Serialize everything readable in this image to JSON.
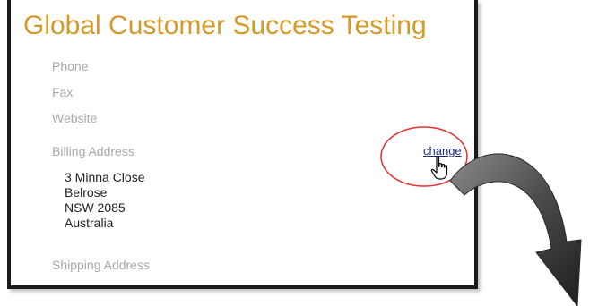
{
  "header": {
    "title": "Global Customer Success Testing"
  },
  "fields": {
    "phone_label": "Phone",
    "fax_label": "Fax",
    "website_label": "Website",
    "billing_label": "Billing Address",
    "shipping_label": "Shipping Address"
  },
  "billing_address": {
    "line1": "3 Minna Close",
    "line2": "Belrose",
    "line3": "NSW 2085",
    "line4": "Australia"
  },
  "actions": {
    "change_label": "change"
  },
  "colors": {
    "title": "#d49a2a",
    "label": "#a8a8a8",
    "link": "#1a2a8a",
    "highlight": "#e03030",
    "arrow": "#3a3a3a"
  },
  "icons": {
    "cursor": "hand-pointer-icon",
    "callout_arrow": "curved-arrow-icon",
    "highlight": "red-ellipse-annotation"
  }
}
